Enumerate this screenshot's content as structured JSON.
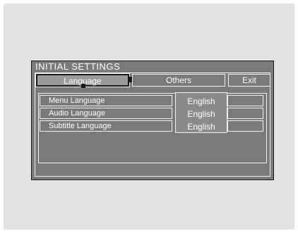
{
  "window": {
    "title": "INITIAL SETTINGS"
  },
  "tabs": [
    {
      "label": "Language",
      "selected": true
    },
    {
      "label": "Others",
      "selected": false
    },
    {
      "label": "Exit",
      "selected": false
    }
  ],
  "settings": [
    {
      "label": "Menu Language"
    },
    {
      "label": "Audio Language"
    },
    {
      "label": "Subtitle Language"
    }
  ],
  "dropdown": {
    "options": [
      "English",
      "English",
      "English"
    ]
  },
  "colors": {
    "osd_background": "#7a7a7a",
    "border": "#f0f0f0",
    "text": "#ffffff"
  }
}
